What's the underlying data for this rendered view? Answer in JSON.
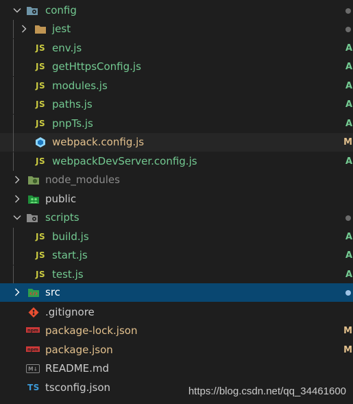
{
  "colors": {
    "background": "#1e1e1e",
    "hover_row": "#262626",
    "selected_row": "#094771",
    "added": "#73c991",
    "modified": "#e2c08d",
    "ignored": "#8c8c8c",
    "default": "#cccccc",
    "js_yellow": "#cbcb41"
  },
  "tree": {
    "config": {
      "label": "config",
      "badge": "",
      "dot": true,
      "expanded": true
    },
    "jest": {
      "label": "jest",
      "dot": true,
      "expanded": false
    },
    "env": {
      "label": "env.js",
      "icon": "JS",
      "badge": "A"
    },
    "getHttpsConfig": {
      "label": "getHttpsConfig.js",
      "icon": "JS",
      "badge": "A"
    },
    "modules": {
      "label": "modules.js",
      "icon": "JS",
      "badge": "A"
    },
    "paths": {
      "label": "paths.js",
      "icon": "JS",
      "badge": "A"
    },
    "pnpTs": {
      "label": "pnpTs.js",
      "icon": "JS",
      "badge": "A"
    },
    "webpackConfig": {
      "label": "webpack.config.js",
      "badge": "M"
    },
    "webpackDevServer": {
      "label": "webpackDevServer.config.js",
      "icon": "JS",
      "badge": "A"
    },
    "node_modules": {
      "label": "node_modules",
      "expanded": false
    },
    "public": {
      "label": "public",
      "expanded": false
    },
    "scripts": {
      "label": "scripts",
      "dot": true,
      "expanded": true
    },
    "build": {
      "label": "build.js",
      "icon": "JS",
      "badge": "A"
    },
    "start": {
      "label": "start.js",
      "icon": "JS",
      "badge": "A"
    },
    "test": {
      "label": "test.js",
      "icon": "JS",
      "badge": "A"
    },
    "src": {
      "label": "src",
      "dot": true,
      "expanded": false
    },
    "gitignore": {
      "label": ".gitignore"
    },
    "packageLock": {
      "label": "package-lock.json",
      "icon": "npm",
      "badge": "M"
    },
    "packageJson": {
      "label": "package.json",
      "icon": "npm",
      "badge": "M"
    },
    "readme": {
      "label": "README.md",
      "icon": "M↓"
    },
    "tsconfig": {
      "label": "tsconfig.json",
      "icon": "TS"
    }
  },
  "watermark": "https://blog.csdn.net/qq_34461600"
}
